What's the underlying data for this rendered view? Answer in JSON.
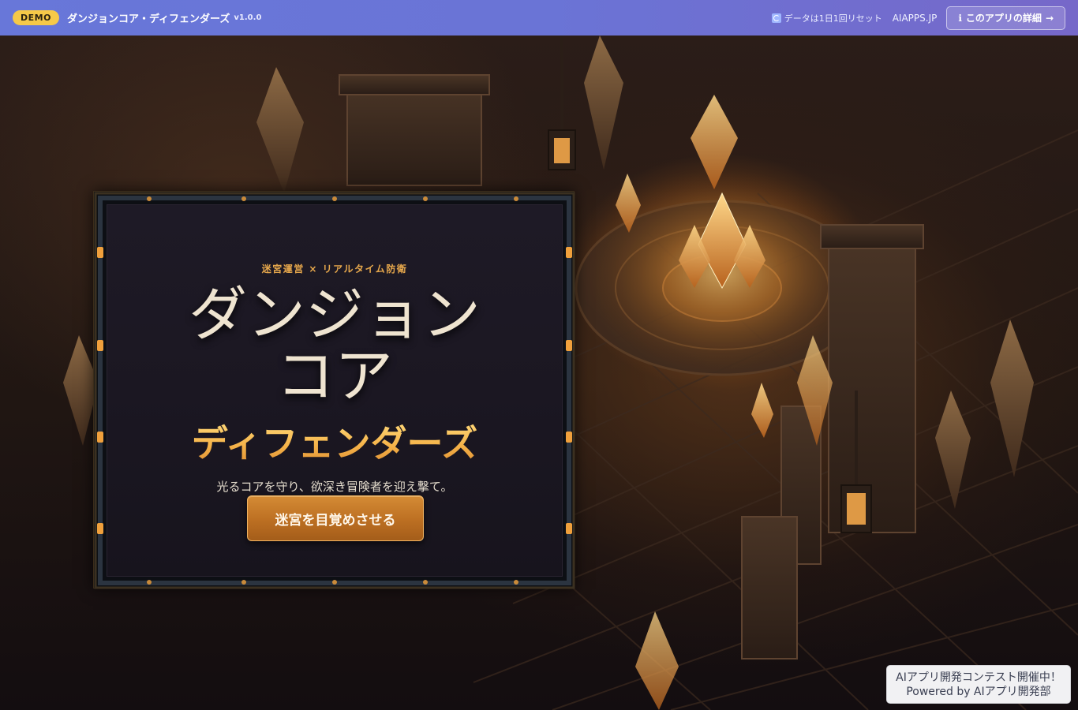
{
  "topbar": {
    "badge": "DEMO",
    "app_title": "ダンジョンコア・ディフェンダーズ",
    "version": "v1.0.0",
    "reset_note": "データは1日1回リセット",
    "reset_icon": "refresh-icon",
    "site_link": "AIAPPS.JP",
    "details_button": "このアプリの詳細",
    "details_icon": "info-icon",
    "details_arrow": "→"
  },
  "title_screen": {
    "tagline": "迷宮運営 × リアルタイム防衛",
    "title_line1": "ダンジョン",
    "title_line2": "コア",
    "subtitle": "ディフェンダーズ",
    "lead": "光るコアを守り、欲深き冒険者を迎え撃て。",
    "start_button": "迷宮を目覚めさせる"
  },
  "promo": {
    "line1": "AIアプリ開発コンテスト開催中！",
    "line2": "Powered by AIアプリ開発部"
  },
  "colors": {
    "topbar_gradient_start": "#6877d9",
    "topbar_gradient_end": "#7668c9",
    "badge": "#f6c948",
    "tagline": "#e7a84c",
    "title": "#efe4d0",
    "subtitle_gold": "#f5b349",
    "button": "#bc6f22",
    "panel": "#1b1722"
  }
}
